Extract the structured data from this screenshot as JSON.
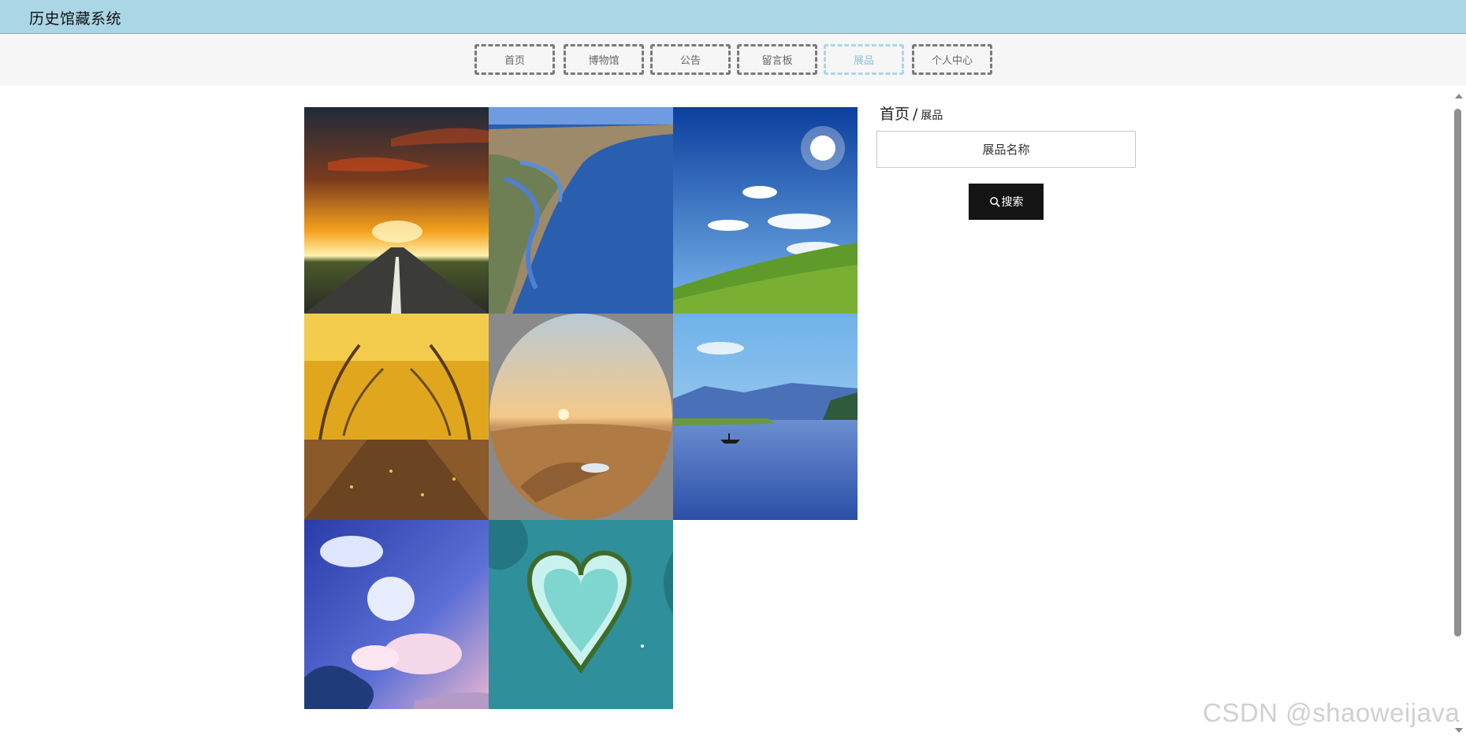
{
  "app": {
    "title": "历史馆藏系统"
  },
  "nav": {
    "items": [
      {
        "label": "首页",
        "active": false
      },
      {
        "label": "博物馆",
        "active": false
      },
      {
        "label": "公告",
        "active": false
      },
      {
        "label": "留言板",
        "active": false
      },
      {
        "label": "展品",
        "active": true
      },
      {
        "label": "个人中心",
        "active": false
      }
    ]
  },
  "breadcrumb": {
    "home": "首页",
    "separator": "/",
    "current": "展品"
  },
  "search": {
    "placeholder": "展品名称",
    "value": "",
    "button_label": "搜索"
  },
  "gallery": {
    "tiles": [
      {
        "name": "sunset-road-image"
      },
      {
        "name": "river-delta-image"
      },
      {
        "name": "sunny-meadow-image"
      },
      {
        "name": "autumn-trees-image"
      },
      {
        "name": "desert-oasis-image"
      },
      {
        "name": "lake-boat-image"
      },
      {
        "name": "anime-sky-image"
      },
      {
        "name": "heart-island-image"
      }
    ]
  },
  "watermark": {
    "text": "CSDN @shaoweijava"
  },
  "colors": {
    "topbar": "#abd6e6",
    "active_nav": "#8cc3d8",
    "search_button": "#141414"
  }
}
